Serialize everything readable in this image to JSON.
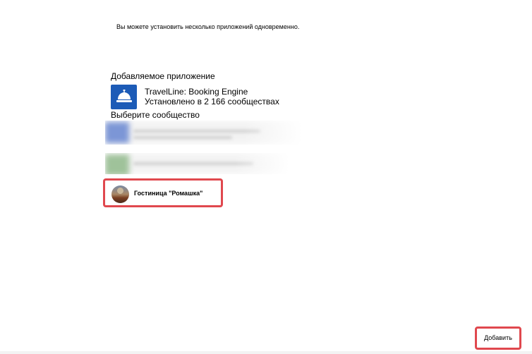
{
  "intro_text": "Вы можете установить несколько приложений одновременно.",
  "added_section": {
    "title": "Добавляемое приложение",
    "app": {
      "name": "TravelLine: Booking Engine",
      "installs": "Установлено в 2 166 сообществах",
      "icon": "service-bell-icon",
      "icon_color": "#1c5bb7"
    }
  },
  "choose_section": {
    "title": "Выберите сообщество",
    "selected_community": {
      "name": "Гостиница \"Ромашка\""
    }
  },
  "footer": {
    "add_label": "Добавить"
  },
  "colors": {
    "highlight": "#e0484e"
  }
}
